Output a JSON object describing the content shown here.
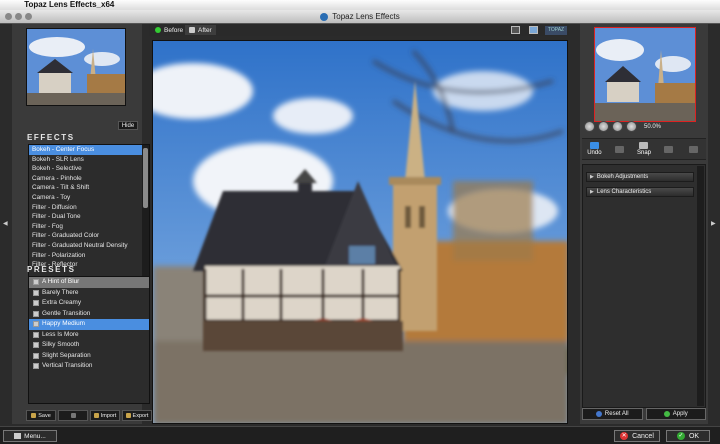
{
  "menubar": {
    "app_name": "Topaz Lens Effects_x64"
  },
  "window": {
    "title": "Topaz Lens Effects"
  },
  "left": {
    "hide_label": "Hide",
    "effects_title": "EFFECTS",
    "effects": [
      "Bokeh - Center Focus",
      "Bokeh - SLR Lens",
      "Bokeh - Selective",
      "Camera - Pinhole",
      "Camera - Tilt & Shift",
      "Camera - Toy",
      "Filter - Diffusion",
      "Filter - Dual Tone",
      "Filter - Fog",
      "Filter - Graduated Color",
      "Filter - Graduated Neutral Density",
      "Filter - Polarization",
      "Filter - Reflector"
    ],
    "presets_title": "PRESETS",
    "presets": [
      "A Hint of Blur",
      "Barely There",
      "Extra Creamy",
      "Gentle Transition",
      "Happy Medium",
      "Less Is More",
      "Silky Smooth",
      "Slight Separation",
      "Vertical Transition"
    ],
    "buttons": {
      "save": "Save",
      "import": "Import",
      "export": "Export"
    }
  },
  "center": {
    "tab_before": "Before",
    "tab_after": "After"
  },
  "right": {
    "zoom_level": "50.0%",
    "undo": "Undo",
    "snap": "Snap",
    "sections": [
      "Bokeh Adjustments",
      "Lens Characteristics"
    ],
    "reset_all": "Reset All",
    "apply": "Apply"
  },
  "footer": {
    "menu": "Menu...",
    "cancel": "Cancel",
    "ok": "OK"
  }
}
